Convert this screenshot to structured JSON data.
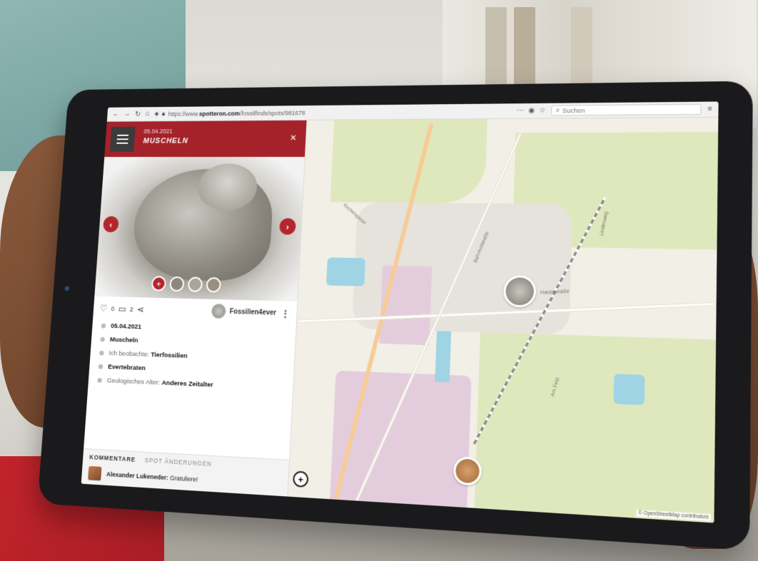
{
  "browser": {
    "url_prefix": "https://www.",
    "url_domain": "spotteron.com",
    "url_path": "/fossilfinds/spots/981678",
    "search_placeholder": "Suchen"
  },
  "spot": {
    "date": "05.04.2021",
    "title": "MUSCHELN",
    "close_label": "×"
  },
  "gallery": {
    "prev_label": "‹",
    "next_label": "›",
    "add_label": "+"
  },
  "actions": {
    "likes": "0",
    "comments_count": "2",
    "username": "Fossilien4ever"
  },
  "details": {
    "date": "05.04.2021",
    "name": "Muscheln",
    "observe_label": "Ich beobachte:",
    "observe_value": "Tierfossilien",
    "group_value": "Evertebraten",
    "age_label": "Geologisches Alter:",
    "age_value": "Anderes Zeitalter"
  },
  "comments": {
    "tab_active": "KOMMENTARE",
    "tab_other": "SPOT ÄNDERUNGEN",
    "items": [
      {
        "author": "Alexander Lukeneder:",
        "text": "Gratuliere!"
      }
    ]
  },
  "map": {
    "zoom_label": "+",
    "attribution": "© OpenStreetMap contributors",
    "streets": [
      "Bahnhofstraße",
      "Hauptstraße",
      "Kirchengasse",
      "Lindenweg",
      "Am Feld"
    ]
  }
}
